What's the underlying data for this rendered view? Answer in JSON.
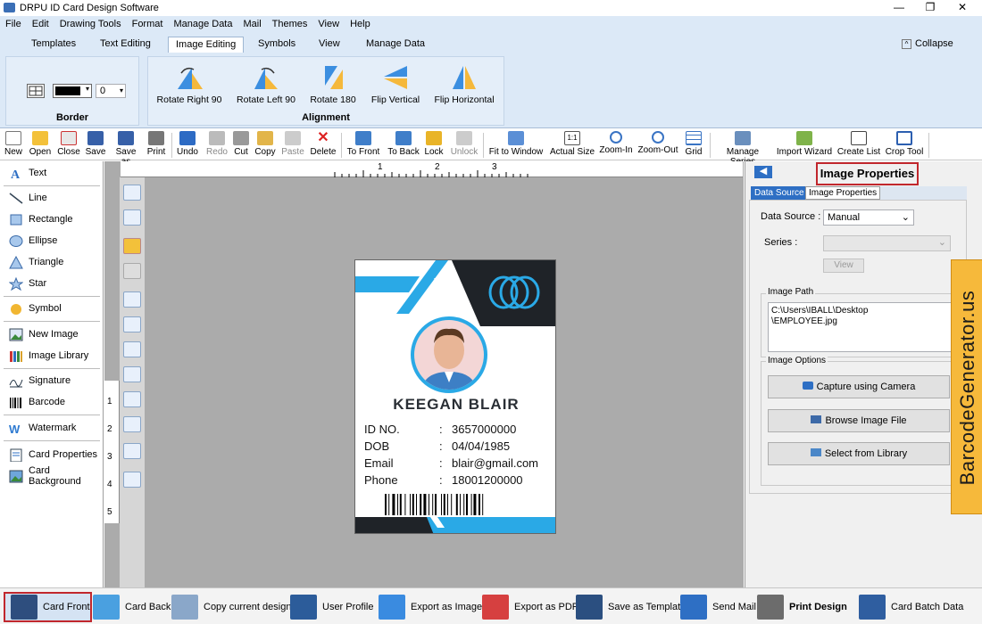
{
  "app": {
    "title": "DRPU ID Card Design Software"
  },
  "window_controls": {
    "minimize": "—",
    "maximize": "❐",
    "close": "✕"
  },
  "menu": [
    "File",
    "Edit",
    "Drawing Tools",
    "Format",
    "Manage Data",
    "Mail",
    "Themes",
    "View",
    "Help"
  ],
  "ribbon_tabs": [
    "Templates",
    "Text Editing",
    "Image Editing",
    "Symbols",
    "View",
    "Manage Data"
  ],
  "active_tab": "Image Editing",
  "collapse_label": "Collapse",
  "border_group": {
    "label": "Border",
    "width_value": "0"
  },
  "alignment_group": {
    "label": "Alignment",
    "buttons": [
      "Rotate Right 90",
      "Rotate Left 90",
      "Rotate 180",
      "Flip Vertical",
      "Flip Horizontal"
    ]
  },
  "toolbar": [
    "New",
    "Open",
    "Close",
    "Save",
    "Save as",
    "Print",
    "Undo",
    "Redo",
    "Cut",
    "Copy",
    "Paste",
    "Delete",
    "To Front",
    "To Back",
    "Lock",
    "Unlock",
    "Fit to Window",
    "Actual Size",
    "Zoom-In",
    "Zoom-Out",
    "Grid",
    "Manage Series",
    "Import Wizard",
    "Create List",
    "Crop Tool"
  ],
  "left_tools": [
    "Text",
    "Line",
    "Rectangle",
    "Ellipse",
    "Triangle",
    "Star",
    "Symbol",
    "New Image",
    "Image Library",
    "Signature",
    "Barcode",
    "Watermark",
    "Card Properties",
    "Card Background"
  ],
  "ruler_top": [
    "1",
    "2",
    "3"
  ],
  "ruler_left": [
    "1",
    "2",
    "3",
    "4",
    "5"
  ],
  "card": {
    "name": "KEEGAN BLAIR",
    "fields": [
      {
        "label": "ID NO.",
        "sep": ":",
        "value": "3657000000"
      },
      {
        "label": "DOB",
        "sep": ":",
        "value": "04/04/1985"
      },
      {
        "label": "Email",
        "sep": ":",
        "value": "blair@gmail.com"
      },
      {
        "label": "Phone",
        "sep": ":",
        "value": "18001200000"
      }
    ],
    "colors": {
      "accent": "#2aa9e6",
      "dark": "#1f2328"
    }
  },
  "properties": {
    "title": "Image Properties",
    "tabs": [
      "Data Source",
      "Image Properties"
    ],
    "data_source_label": "Data Source :",
    "data_source_value": "Manual",
    "series_label": "Series :",
    "view_button": "View",
    "image_path_label": "Image Path",
    "image_path_value": "C:\\Users\\IBALL\\Desktop\n\\EMPLOYEE.jpg",
    "image_options_label": "Image Options",
    "capture_button": "Capture using Camera",
    "browse_button": "Browse Image File",
    "library_button": "Select from Library"
  },
  "watermark_tag": "BarcodeGenerator.us",
  "bottom_bar": [
    "Card Front",
    "Card Back",
    "Copy current design",
    "User Profile",
    "Export as Image",
    "Export as PDF",
    "Save as Template",
    "Send Mail",
    "Print Design",
    "Card Batch Data"
  ]
}
